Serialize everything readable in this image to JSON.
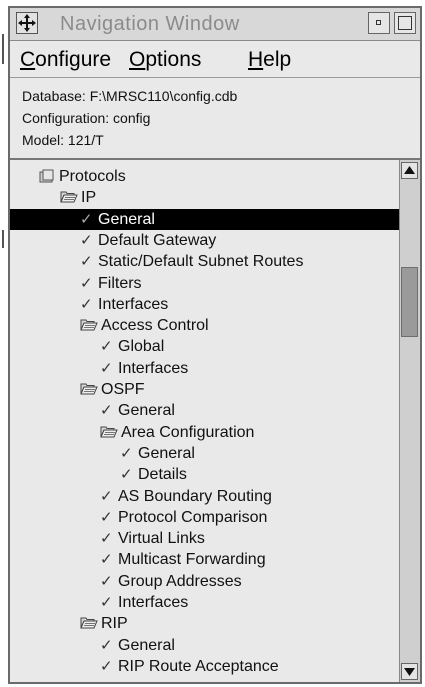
{
  "window": {
    "title": "Navigation Window"
  },
  "menubar": {
    "items": [
      {
        "label_u": "C",
        "label_rest": "onfigure"
      },
      {
        "label_u": "O",
        "label_rest": "ptions"
      },
      {
        "label_u": "H",
        "label_rest": "elp"
      }
    ]
  },
  "info": {
    "database": "Database:  F:\\MRSC110\\config.cdb",
    "configuration": "Configuration:  config",
    "model": "Model:  121/T"
  },
  "tree": {
    "selected_index": 2,
    "items": [
      {
        "label": "Protocols",
        "type": "root-folder",
        "level": 0
      },
      {
        "label": "IP",
        "type": "folder",
        "level": 1
      },
      {
        "label": "General",
        "type": "check",
        "level": 2
      },
      {
        "label": "Default Gateway",
        "type": "check",
        "level": 2
      },
      {
        "label": "Static/Default Subnet Routes",
        "type": "check",
        "level": 2
      },
      {
        "label": "Filters",
        "type": "check",
        "level": 2
      },
      {
        "label": "Interfaces",
        "type": "check",
        "level": 2
      },
      {
        "label": "Access Control",
        "type": "folder",
        "level": 2
      },
      {
        "label": "Global",
        "type": "check",
        "level": 3
      },
      {
        "label": "Interfaces",
        "type": "check",
        "level": 3
      },
      {
        "label": "OSPF",
        "type": "folder",
        "level": 2
      },
      {
        "label": "General",
        "type": "check",
        "level": 3
      },
      {
        "label": "Area Configuration",
        "type": "folder",
        "level": 3
      },
      {
        "label": "General",
        "type": "check",
        "level": 4
      },
      {
        "label": "Details",
        "type": "check",
        "level": 4
      },
      {
        "label": "AS Boundary Routing",
        "type": "check",
        "level": 3
      },
      {
        "label": "Protocol Comparison",
        "type": "check",
        "level": 3
      },
      {
        "label": "Virtual Links",
        "type": "check",
        "level": 3
      },
      {
        "label": "Multicast Forwarding",
        "type": "check",
        "level": 3
      },
      {
        "label": "Group Addresses",
        "type": "check",
        "level": 3
      },
      {
        "label": "Interfaces",
        "type": "check",
        "level": 3
      },
      {
        "label": "RIP",
        "type": "folder",
        "level": 2
      },
      {
        "label": "General",
        "type": "check",
        "level": 3
      },
      {
        "label": "RIP Route Acceptance",
        "type": "check",
        "level": 3
      }
    ]
  },
  "icons": {
    "system_menu": "diamond-arrows-icon",
    "check": "checkmark-icon",
    "folder": "open-folder-icon",
    "root": "closed-folder-icon"
  }
}
